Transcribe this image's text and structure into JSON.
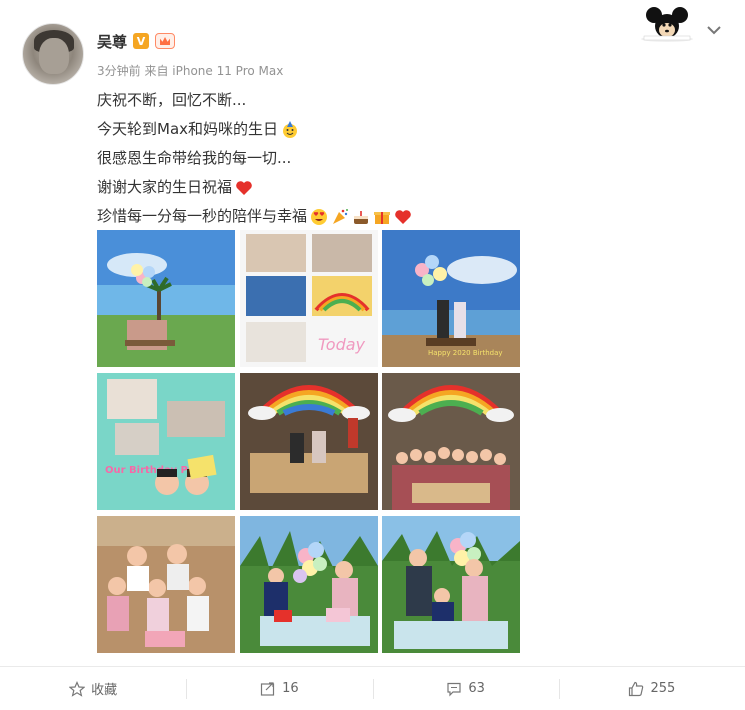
{
  "post": {
    "author": "吴尊",
    "meta": "3分钟前 来自 iPhone 11 Pro Max",
    "lines": [
      "庆祝不断，回忆不断...",
      "今天轮到Max和妈咪的生日",
      "很感恩生命带给我的每一切...",
      "谢谢大家的生日祝福",
      "珍惜每一分每一秒的陪伴与幸福"
    ],
    "emoji_icons": [
      "birthday-face-emoji",
      "red-heart-emoji",
      "heart-eyes-emoji",
      "party-popper-emoji",
      "cake-emoji",
      "gift-emoji",
      "red-heart-emoji"
    ],
    "photo_captions": [
      "Happy 2020 Birthday",
      "Our Birthday Party",
      "Today"
    ]
  },
  "actions": {
    "favorite_label": "收藏",
    "repost_count": "16",
    "comment_count": "63",
    "like_count": "255"
  },
  "colors": {
    "accent": "#ff8200",
    "text": "#333333",
    "meta": "#939393",
    "heart": "#e5312b"
  }
}
